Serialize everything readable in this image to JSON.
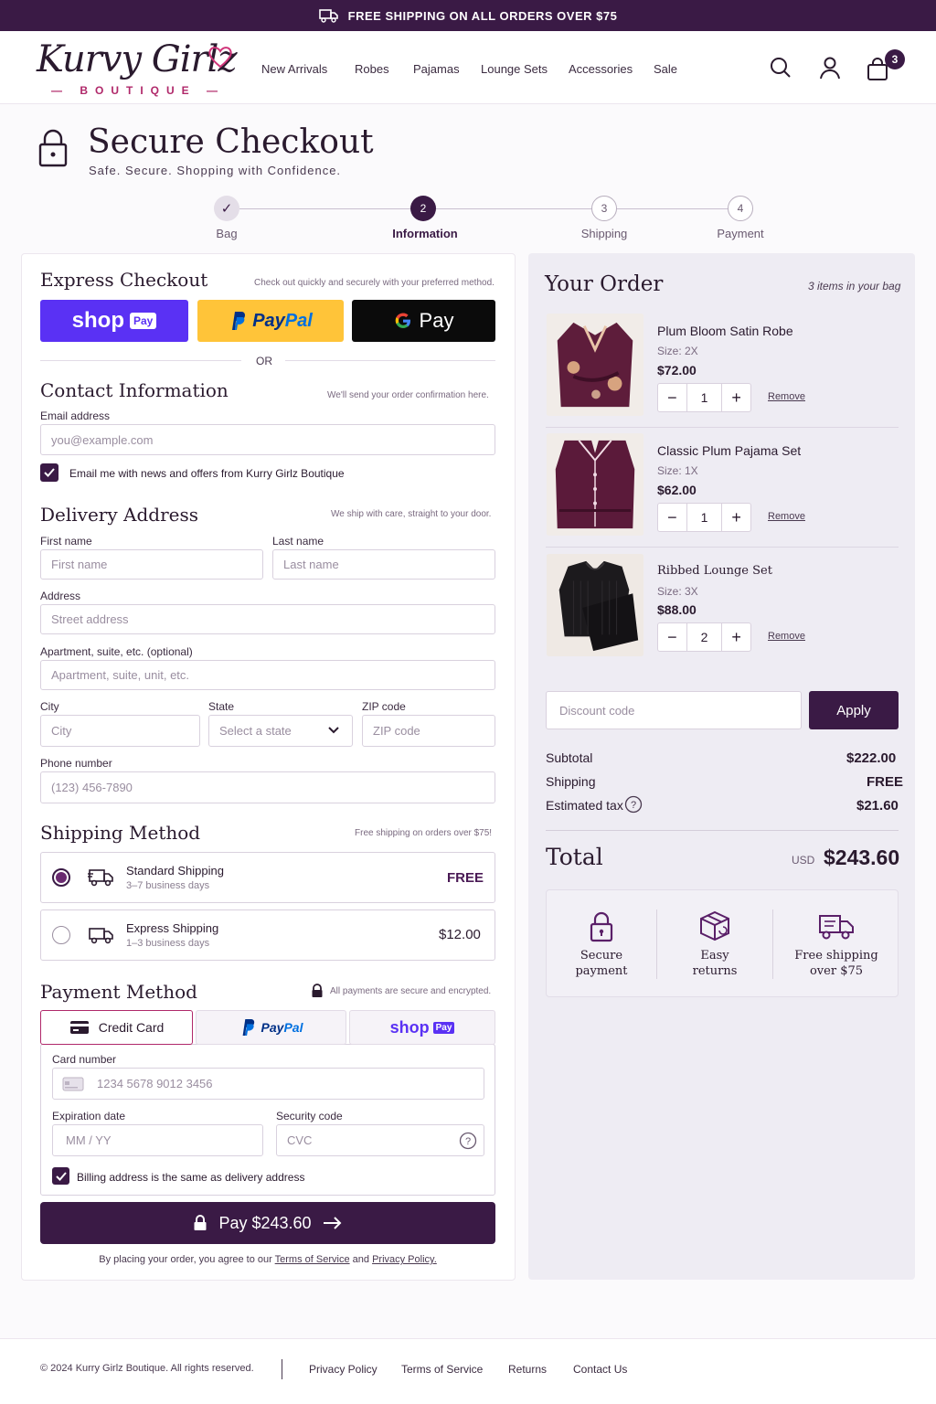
{
  "banner": {
    "text": "FREE SHIPPING ON ALL ORDERS OVER $75"
  },
  "brand": {
    "name": "Kurvy Girlz",
    "sub": "— BOUTIQUE —",
    "accent": "#3a1a45",
    "pink": "#b0286a"
  },
  "nav": {
    "items": [
      "New Arrivals",
      "Robes",
      "Pajamas",
      "Lounge Sets",
      "Accessories",
      "Sale"
    ]
  },
  "cart": {
    "count": "3"
  },
  "page": {
    "title": "Secure Checkout",
    "subtitle": "Safe. Secure. Shopping with Confidence."
  },
  "steps": [
    {
      "num": "✓",
      "label": "Bag"
    },
    {
      "num": "2",
      "label": "Information"
    },
    {
      "num": "3",
      "label": "Shipping"
    },
    {
      "num": "4",
      "label": "Payment"
    }
  ],
  "express": {
    "title": "Express Checkout",
    "note": "Check out quickly and securely with your preferred method.",
    "shop": "shop",
    "shop_pay": "Pay",
    "paypal_p": "Pay",
    "paypal_pal": "Pal",
    "gpay": "Pay",
    "or": "OR"
  },
  "contact": {
    "title": "Contact Information",
    "note": "We'll send your order confirmation here.",
    "email_label": "Email address",
    "email_placeholder": "you@example.com",
    "newsletter": "Email me with news and offers from Kurry Girlz Boutique"
  },
  "delivery": {
    "title": "Delivery Address",
    "note": "We ship with care, straight to your door.",
    "first_label": "First name",
    "first_placeholder": "First name",
    "last_label": "Last name",
    "last_placeholder": "Last name",
    "address_label": "Address",
    "address_placeholder": "Street address",
    "apt_label": "Apartment, suite, etc. (optional)",
    "apt_placeholder": "Apartment, suite, unit, etc.",
    "city_label": "City",
    "city_placeholder": "City",
    "state_label": "State",
    "state_value": "Select a state",
    "zip_label": "ZIP code",
    "zip_placeholder": "ZIP code",
    "phone_label": "Phone number",
    "phone_placeholder": "(123) 456-7890"
  },
  "shipping": {
    "title": "Shipping Method",
    "note": "Free shipping on orders over $75!",
    "standard": {
      "name": "Standard Shipping",
      "days": "3–7 business days",
      "price": "FREE"
    },
    "express": {
      "name": "Express Shipping",
      "days": "1–3 business days",
      "price": "$12.00"
    }
  },
  "payment": {
    "title": "Payment Method",
    "note": "All payments are secure and encrypted.",
    "tab_card": "Credit Card",
    "tab_paypal_p": "Pay",
    "tab_paypal_pal": "Pal",
    "tab_shop": "shop",
    "tab_shop_pay": "Pay",
    "card_label": "Card number",
    "card_placeholder": "1234 5678 9012 3456",
    "exp_label": "Expiration date",
    "exp_placeholder": "MM / YY",
    "cvc_label": "Security code",
    "cvc_placeholder": "CVC",
    "billing": "Billing address is the same as delivery address",
    "pay_button": "Pay $243.60",
    "terms_pre": "By placing your order, you agree to our",
    "terms_link": "Terms of Service",
    "terms_and": "and",
    "privacy_link": "Privacy Policy."
  },
  "order": {
    "title": "Your Order",
    "count": "3 items in your bag",
    "items": [
      {
        "name": "Plum Bloom Satin Robe",
        "size": "Size: 2X",
        "price": "$72.00",
        "qty": "1",
        "remove": "Remove"
      },
      {
        "name": "Classic Plum Pajama Set",
        "size": "Size: 1X",
        "price": "$62.00",
        "qty": "1",
        "remove": "Remove"
      },
      {
        "name": "Ribbed Lounge Set",
        "size": "Size: 3X",
        "price": "$88.00",
        "qty": "2",
        "remove": "Remove"
      }
    ],
    "discount_placeholder": "Discount code",
    "apply": "Apply",
    "subtotal_label": "Subtotal",
    "subtotal": "$222.00",
    "shipping_label": "Shipping",
    "shipping": "FREE",
    "tax_label": "Estimated tax",
    "tax": "$21.60",
    "total_label": "Total",
    "currency": "USD",
    "total": "$243.60"
  },
  "trust": [
    {
      "line1": "Secure",
      "line2": "payment"
    },
    {
      "line1": "Easy",
      "line2": "returns"
    },
    {
      "line1": "Free shipping",
      "line2": "over $75"
    }
  ],
  "footer": {
    "copyright": "© 2024 Kurry Girlz Boutique. All rights reserved.",
    "links": [
      "Privacy Policy",
      "Terms of Service",
      "Returns",
      "Contact Us"
    ]
  }
}
